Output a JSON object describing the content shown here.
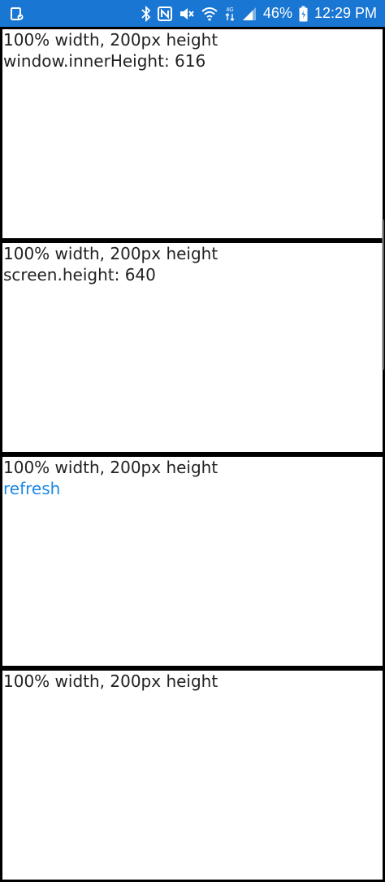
{
  "status_bar": {
    "battery_percent": "46%",
    "time": "12:29 PM",
    "network_label": "4G",
    "colors": {
      "background": "#1976d2",
      "foreground": "#ffffff"
    },
    "icons": [
      "notification-icon",
      "bluetooth-icon",
      "nfc-icon",
      "mute-icon",
      "wifi-icon",
      "data-icon",
      "signal-icon",
      "battery-icon"
    ]
  },
  "boxes": [
    {
      "heading": "100% width, 200px height",
      "info": "window.innerHeight: 616"
    },
    {
      "heading": "100% width, 200px height",
      "info": "screen.height: 640"
    },
    {
      "heading": "100% width, 200px height",
      "link": "refresh"
    },
    {
      "heading": "100% width, 200px height"
    }
  ],
  "colors": {
    "link": "#1e88e5",
    "border": "#000000"
  }
}
